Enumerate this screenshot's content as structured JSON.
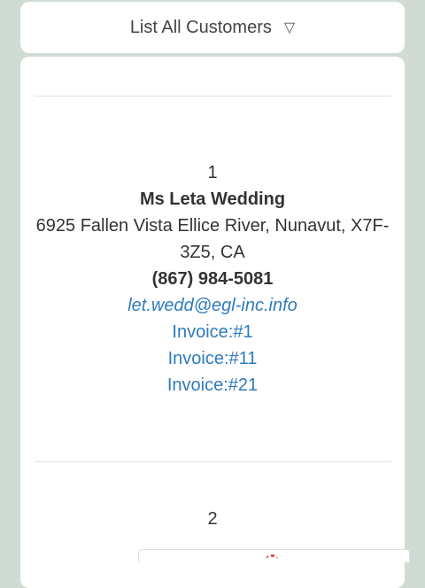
{
  "dropdown": {
    "label": "List All Customers",
    "arrow": "▽"
  },
  "customers": [
    {
      "icon": "",
      "number": "1",
      "name": "Ms Leta Wedding",
      "address": "6925 Fallen Vista Ellice River, Nunavut, X7F-3Z5, CA",
      "phone": "(867) 984-5081",
      "email": "let.wedd@egl-inc.info",
      "invoices": [
        "Invoice:#1",
        "Invoice:#11",
        "Invoice:#21"
      ]
    },
    {
      "icon": "",
      "number": "2"
    }
  ]
}
